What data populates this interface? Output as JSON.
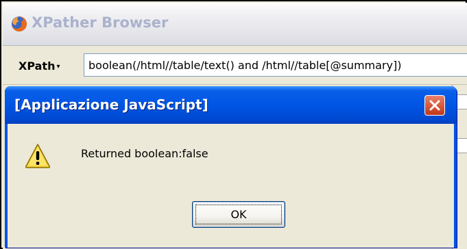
{
  "browser": {
    "title": "XPather Browser",
    "icon": "firefox-icon"
  },
  "toolbar": {
    "xpath_label": "XPath",
    "xpath_query": "boolean(/html//table/text() and /html//table[@summary])"
  },
  "dialog": {
    "title": "[Applicazione JavaScript]",
    "message": "Returned boolean:false",
    "icon": "warning-icon",
    "ok_label": "OK",
    "close_icon": "close-icon"
  },
  "colors": {
    "titlebar_blue": "#0055e5",
    "dialog_face": "#ece9d8",
    "close_red": "#d95b3e",
    "inactive_title": "#aab2cc"
  }
}
